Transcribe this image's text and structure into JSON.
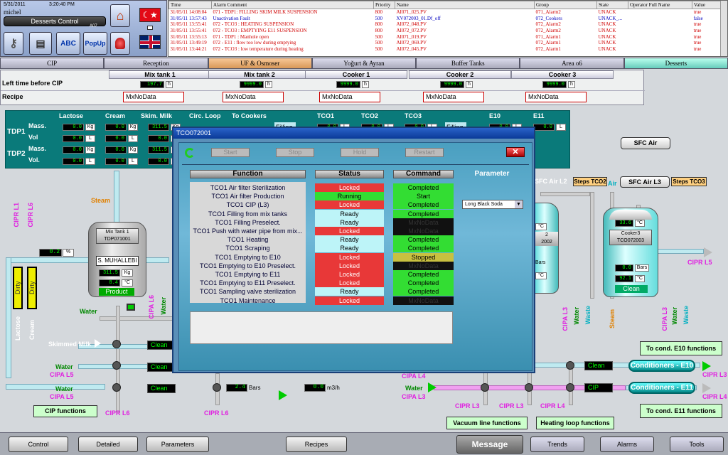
{
  "header": {
    "date": "5/31/2011",
    "time": "3:20:40 PM",
    "user": "michel",
    "screen_name": "Desserts Control",
    "screen_code": "A07",
    "buttons": [
      "ABC",
      "PopUp"
    ]
  },
  "alarm_table": {
    "columns": [
      "Time",
      "Alarm Comment",
      "Priority",
      "Name",
      "Group",
      "State",
      "Operator Full Name",
      "Value"
    ],
    "rows": [
      {
        "time": "31/05/11 14:08:04",
        "comment": "071 - TDP1: FILLING SKIM MILK SUSPENSION",
        "priority": "800",
        "name": "AI071_025.PV",
        "group": "071_Alarm2",
        "state": "UNACK",
        "operator": "",
        "value": "true",
        "color": "#d00000"
      },
      {
        "time": "31/05/11 13:57:43",
        "comment": "Unactivation Fault",
        "priority": "500",
        "name": "XV072003_01.Df_off",
        "group": "072_Cookers",
        "state": "UNACK_...",
        "operator": "",
        "value": "false",
        "color": "#0000c0"
      },
      {
        "time": "31/05/11 13:55:41",
        "comment": "072 - TCO3 : HEATING SUSPENSION",
        "priority": "800",
        "name": "AI072_048.PV",
        "group": "072_Alarm2",
        "state": "UNACK",
        "operator": "",
        "value": "true",
        "color": "#d00000"
      },
      {
        "time": "31/05/11 13:55:41",
        "comment": "072 - TCO3 : EMPTYING E11 SUSPENSION",
        "priority": "800",
        "name": "AI072_072.PV",
        "group": "072_Alarm2",
        "state": "UNACK",
        "operator": "",
        "value": "true",
        "color": "#d00000"
      },
      {
        "time": "31/05/11 13:55:13",
        "comment": "071 - TDP1 : Manhole open",
        "priority": "500",
        "name": "AI071_019.PV",
        "group": "071_Alarm1",
        "state": "UNACK",
        "operator": "",
        "value": "true",
        "color": "#d00000"
      },
      {
        "time": "31/05/11 13:49:19",
        "comment": "072 - E11 : flow too low during emptying",
        "priority": "500",
        "name": "AI072_069.PV",
        "group": "072_Alarm1",
        "state": "UNACK",
        "operator": "",
        "value": "true",
        "color": "#d00000"
      },
      {
        "time": "31/05/11 13:44:21",
        "comment": "072 - TCO3 : low temperature during heating",
        "priority": "500",
        "name": "AI072_045.PV",
        "group": "072_Alarm1",
        "state": "UNACK",
        "operator": "",
        "value": "true",
        "color": "#d00000"
      }
    ]
  },
  "tabs": [
    "CIP",
    "Reception",
    "UF & Osmoser",
    "Yoğurt & Ayran",
    "Buffer Tanks",
    "Area o6",
    "Desserts"
  ],
  "mix": {
    "row_labels": {
      "left_time": "Left time before CIP",
      "recipe": "Recipe"
    },
    "columns": [
      {
        "name": "Mix tank 1",
        "time": "197.7",
        "unit": "h",
        "recipe": "MxNoData"
      },
      {
        "name": "Mix tank 2",
        "time": "9999.0",
        "unit": "h",
        "recipe": "MxNoData"
      },
      {
        "name": "Cooker 1",
        "time": "9999.0",
        "unit": "h",
        "recipe": "MxNoData"
      },
      {
        "name": "Cooker 2",
        "time": "9999.0",
        "unit": "h",
        "recipe": "MxNoData"
      },
      {
        "name": "Cooker 3",
        "time": "9999.0",
        "unit": "h",
        "recipe": "MxNoData"
      }
    ]
  },
  "tdp": {
    "headers": [
      "Lactose",
      "Cream",
      "Skim. Milk",
      "Circ. Loop",
      "To Cookers",
      "TCO1",
      "TCO2",
      "TCO3",
      "E10",
      "E11"
    ],
    "rows": [
      "TDP1",
      "TDP2"
    ],
    "sub": [
      "Mass.",
      "Vol"
    ],
    "sub2": [
      "Mass.",
      "Vol."
    ],
    "val": "0.0",
    "val2": "311.5",
    "kg": "Kg",
    "l": "L",
    "filling": "Filling"
  },
  "plant": {
    "steam": "Steam",
    "sfc_air": "SFC Air",
    "sfc_air_l2": "SFC Air L2",
    "sfc_air_l3": "SFC Air L3",
    "steps_tco2": "Steps TCO2",
    "steps_tco3": "Steps TCO3",
    "air": "Air",
    "mix_tank": {
      "title": "Mix Tank 1",
      "code": "TDP071001",
      "recipe": "S. MUHALLEBI",
      "mass": "311.5",
      "unit_kg": "Kg",
      "temp": "8.4",
      "unit_c": "°C",
      "state": "Product"
    },
    "cooker3": {
      "val": "33.6",
      "unit": "°C",
      "title": "Cooker3",
      "code": "TCO072003",
      "bars": "0.0",
      "bars_unit": "Bars",
      "temp": "92.1",
      "state": "Clean"
    },
    "cooker2": {
      "tag": "2",
      "code": "2002"
    },
    "line_val": "0.2",
    "line_unit": "%",
    "cipr_l1": "CIPR L1",
    "cipr_l6": "CIPR L6",
    "dirty": "Dirty",
    "lactose": "Lactose",
    "cream": "Cream",
    "water": "Water",
    "skimmed_milk": "Skimmed Milk",
    "cipa_l5": "CIPA L5",
    "cipr_l5": "CIPR L5",
    "cipa_l6": "CIPA L6",
    "cipa_l3": "CIPA L3",
    "cipa_l4": "CIPA L4",
    "cipr_l3": "CIPR L3",
    "cipr_l4": "CIPR L4",
    "waste": "Waste",
    "steam_v": "Steam",
    "clean": "Clean",
    "cip": "CIP",
    "bars_val": "2.4",
    "bars": "Bars",
    "flow_val": "0.0",
    "flow_unit": "m3/h",
    "cip_functions": "CIP functions",
    "vacuum": "Vacuum line functions",
    "heating": "Heating loop functions",
    "to_e10": "To cond. E10 functions",
    "to_e11": "To cond. E11 functions",
    "cond_e10": "Conditioners - E10",
    "cond_e11": "Conditioners - E11"
  },
  "dialog": {
    "title": "TCO072001",
    "buttons": [
      "Start",
      "Stop",
      "Hold",
      "Restart"
    ],
    "headers": [
      "Function",
      "Status",
      "Command",
      "Parameter"
    ],
    "parameter": "Long Black Soda",
    "rows": [
      {
        "f": "TCO1 Air filter Sterilization",
        "s": "Locked",
        "sc": "#e83838",
        "c": "Completed",
        "cc": "#33dd33"
      },
      {
        "f": "TCO1 Air filter Production",
        "s": "Running",
        "sc": "#33dd33",
        "c": "Start",
        "cc": "#33dd33"
      },
      {
        "f": "TCO1 CIP (L3)",
        "s": "Locked",
        "sc": "#e83838",
        "c": "Completed",
        "cc": "#33dd33"
      },
      {
        "f": "TCO1 Filling from mix tanks",
        "s": "Ready",
        "sc": "#bdf4f8",
        "c": "Completed",
        "cc": "#33dd33"
      },
      {
        "f": "TCO1 Filling Preselect.",
        "s": "Ready",
        "sc": "#bdf4f8",
        "c": "MxNoData",
        "cc": "#111"
      },
      {
        "f": "TCO1 Push with water pipe from mix...",
        "s": "Locked",
        "sc": "#e83838",
        "c": "MxNoData",
        "cc": "#111"
      },
      {
        "f": "TCO1 Heating",
        "s": "Ready",
        "sc": "#bdf4f8",
        "c": "Completed",
        "cc": "#33dd33"
      },
      {
        "f": "TCO1 Scraping",
        "s": "Ready",
        "sc": "#bdf4f8",
        "c": "Completed",
        "cc": "#33dd33"
      },
      {
        "f": "TCO1 Emptying to E10",
        "s": "Locked",
        "sc": "#e83838",
        "c": "Stopped",
        "cc": "#c8c040"
      },
      {
        "f": "TCO1 Emptying to E10 Preselect.",
        "s": "Locked",
        "sc": "#e83838",
        "c": "MxNoData",
        "cc": "#111"
      },
      {
        "f": "TCO1 Emptying to E11",
        "s": "Locked",
        "sc": "#e83838",
        "c": "Completed",
        "cc": "#33dd33"
      },
      {
        "f": "TCO1 Emptying to E11 Preselect.",
        "s": "Locked",
        "sc": "#e83838",
        "c": "Completed",
        "cc": "#33dd33"
      },
      {
        "f": "TCO1 Sampling valve sterilization",
        "s": "Ready",
        "sc": "#bdf4f8",
        "c": "Completed",
        "cc": "#33dd33"
      },
      {
        "f": "TCO1 Maintenance",
        "s": "Locked",
        "sc": "#e83838",
        "c": "MxNoData",
        "cc": "#111"
      }
    ]
  },
  "bottom": {
    "buttons": [
      "Control",
      "Detailed",
      "Parameters",
      "Recipes",
      "Message",
      "Trends",
      "Alarms",
      "Tools"
    ]
  }
}
